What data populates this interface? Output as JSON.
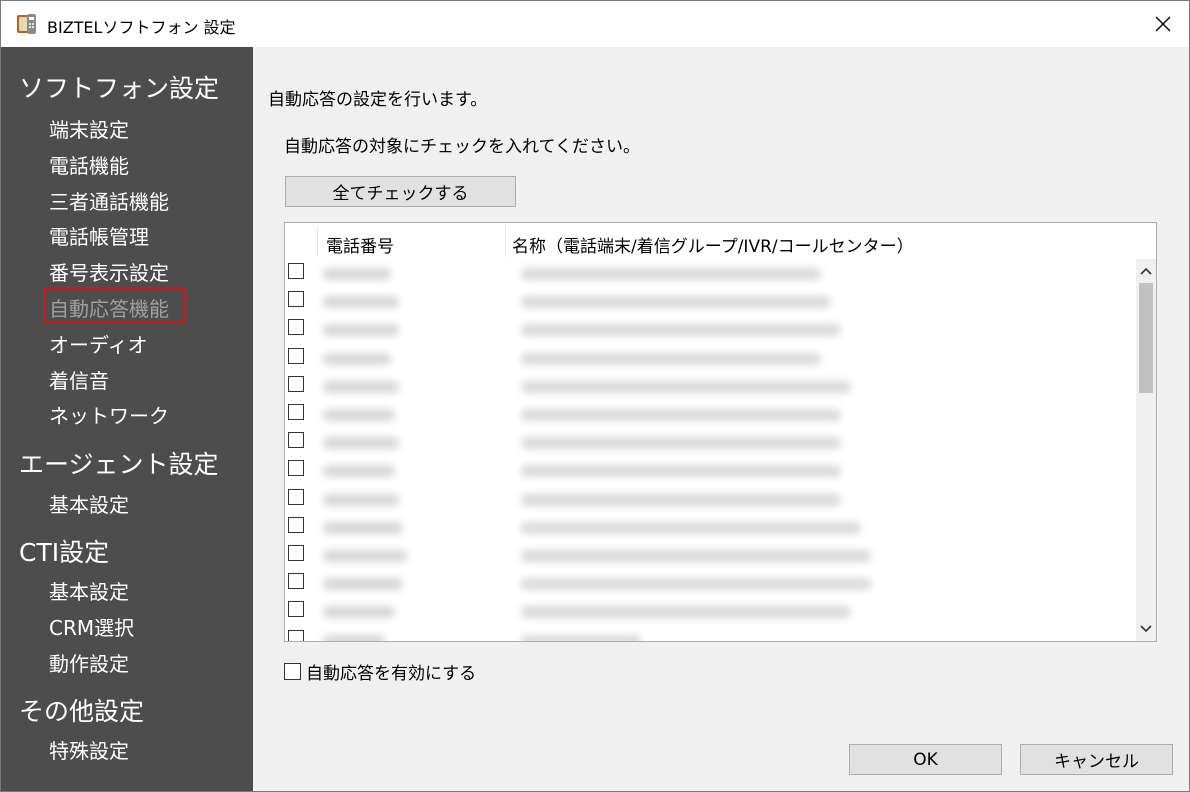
{
  "window": {
    "title": "BIZTELソフトフォン 設定",
    "app_icon": "phone-app-icon",
    "close_icon": "close-icon"
  },
  "sidebar": {
    "categories": [
      {
        "label": "ソフトフォン設定",
        "items": [
          "端末設定",
          "電話機能",
          "三者通話機能",
          "電話帳管理",
          "番号表示設定",
          "自動応答機能",
          "オーディオ",
          "着信音",
          "ネットワーク"
        ]
      },
      {
        "label": "エージェント設定",
        "items": [
          "基本設定"
        ]
      },
      {
        "label": "CTI設定",
        "items": [
          "基本設定",
          "CRM選択",
          "動作設定"
        ]
      },
      {
        "label": "その他設定",
        "items": [
          "特殊設定"
        ]
      }
    ],
    "active_item": "自動応答機能",
    "highlight_color": "#d8141a"
  },
  "main": {
    "heading": "自動応答の設定を行います。",
    "instruction": "自動応答の対象にチェックを入れてください。",
    "check_all_label": "全てチェックする",
    "list": {
      "columns": [
        "電話番号",
        "名称（電話端末/着信グループ/IVR/コールセンター）"
      ],
      "rows_visible": 14,
      "row_content": "blurred"
    },
    "enable_label": "自動応答を有効にする",
    "enable_checked": false,
    "ok_label": "OK",
    "cancel_label": "キャンセル"
  }
}
